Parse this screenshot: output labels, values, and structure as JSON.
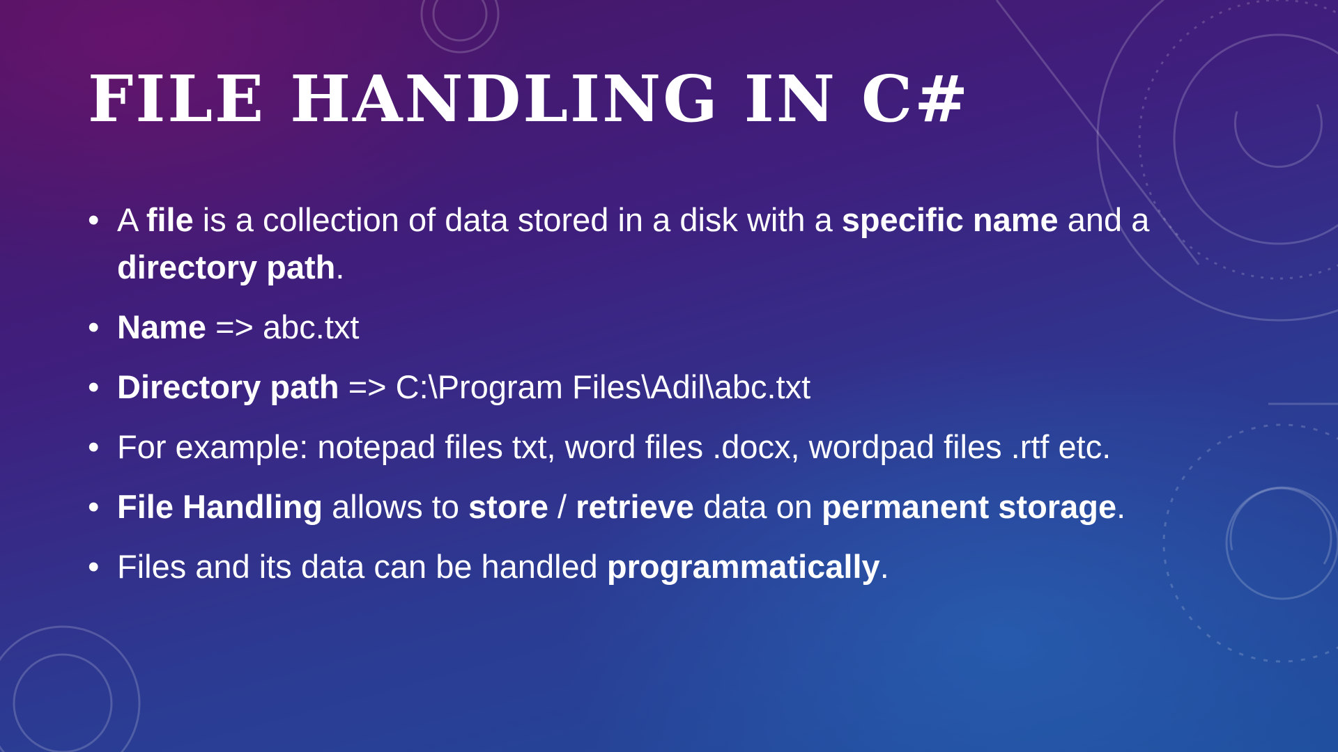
{
  "slide": {
    "title": "FILE HANDLING IN C#",
    "bullets": [
      [
        {
          "text": "A ",
          "bold": false
        },
        {
          "text": "file",
          "bold": true
        },
        {
          "text": " is a collection of data stored in a disk with a ",
          "bold": false
        },
        {
          "text": "specific name",
          "bold": true
        },
        {
          "text": " and a ",
          "bold": false
        },
        {
          "text": "directory path",
          "bold": true
        },
        {
          "text": ".",
          "bold": false
        }
      ],
      [
        {
          "text": "Name",
          "bold": true
        },
        {
          "text": " => abc.txt",
          "bold": false
        }
      ],
      [
        {
          "text": "Directory path",
          "bold": true
        },
        {
          "text": " => C:\\Program Files\\Adil\\abc.txt",
          "bold": false
        }
      ],
      [
        {
          "text": "For example: notepad files txt, word files .docx, wordpad files .rtf etc.",
          "bold": false
        }
      ],
      [
        {
          "text": "File Handling",
          "bold": true
        },
        {
          "text": " allows to ",
          "bold": false
        },
        {
          "text": "store",
          "bold": true
        },
        {
          "text": " / ",
          "bold": false
        },
        {
          "text": "retrieve",
          "bold": true
        },
        {
          "text": " data on ",
          "bold": false
        },
        {
          "text": "permanent storage",
          "bold": true
        },
        {
          "text": ".",
          "bold": false
        }
      ],
      [
        {
          "text": "Files and its data can be handled ",
          "bold": false
        },
        {
          "text": "programmatically",
          "bold": true
        },
        {
          "text": ".",
          "bold": false
        }
      ]
    ]
  },
  "theme": {
    "text_color": "#ffffff",
    "background_top": "#4a1462",
    "background_bottom": "#1f4c9c"
  }
}
